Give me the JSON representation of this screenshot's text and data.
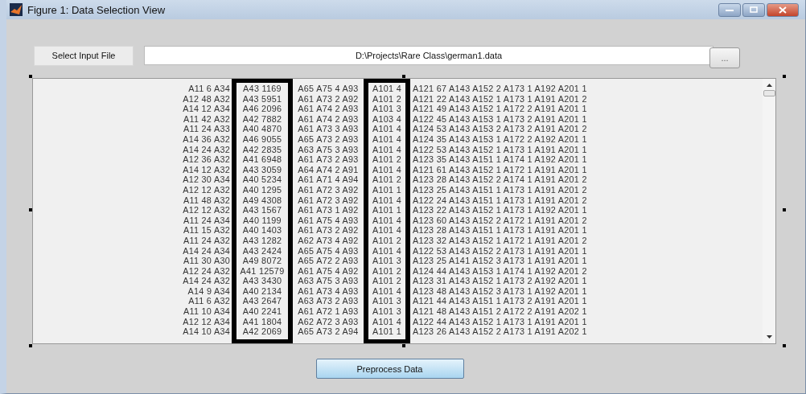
{
  "window": {
    "title": "Figure 1: Data Selection View"
  },
  "file_row": {
    "select_button": "Select Input File",
    "path": "D:\\Projects\\Rare Class\\german1.data",
    "browse_button": "..."
  },
  "list_rows": [
    "A11 6 A34 A43 1169 A65 A75 4 A93 A101 4 A121 67 A143 A152 2 A173 1 A192 A201 1",
    "A12 48 A32 A43 5951 A61 A73 2 A92 A101 2 A121 22 A143 A152 1 A173 1 A191 A201 2",
    "A14 12 A34 A46 2096 A61 A74 2 A93 A101 3 A121 49 A143 A152 1 A172 2 A191 A201 1",
    "A11 42 A32 A42 7882 A61 A74 2 A93 A103 4 A122 45 A143 A153 1 A173 2 A191 A201 1",
    "A11 24 A33 A40 4870 A61 A73 3 A93 A101 4 A124 53 A143 A153 2 A173 2 A191 A201 2",
    "A14 36 A32 A46 9055 A65 A73 2 A93 A101 4 A124 35 A143 A153 1 A172 2 A192 A201 1",
    "A14 24 A32 A42 2835 A63 A75 3 A93 A101 4 A122 53 A143 A152 1 A173 1 A191 A201 1",
    "A12 36 A32 A41 6948 A61 A73 2 A93 A101 2 A123 35 A143 A151 1 A174 1 A192 A201 1",
    "A14 12 A32 A43 3059 A64 A74 2 A91 A101 4 A121 61 A143 A152 1 A172 1 A191 A201 1",
    "A12 30 A34 A40 5234 A61 A71 4 A94 A101 2 A123 28 A143 A152 2 A174 1 A191 A201 2",
    "A12 12 A32 A40 1295 A61 A72 3 A92 A101 1 A123 25 A143 A151 1 A173 1 A191 A201 2",
    "A11 48 A32 A49 4308 A61 A72 3 A92 A101 4 A122 24 A143 A151 1 A173 1 A191 A201 2",
    "A12 12 A32 A43 1567 A61 A73 1 A92 A101 1 A123 22 A143 A152 1 A173 1 A192 A201 1",
    "A11 24 A34 A40 1199 A61 A75 4 A93 A101 4 A123 60 A143 A152 2 A172 1 A191 A201 2",
    "A11 15 A32 A40 1403 A61 A73 2 A92 A101 4 A123 28 A143 A151 1 A173 1 A191 A201 1",
    "A11 24 A32 A43 1282 A62 A73 4 A92 A101 2 A123 32 A143 A152 1 A172 1 A191 A201 2",
    "A14 24 A34 A43 2424 A65 A75 4 A93 A101 4 A122 53 A143 A152 2 A173 1 A191 A201 1",
    "A11 30 A30 A49 8072 A65 A72 2 A93 A101 3 A123 25 A141 A152 3 A173 1 A191 A201 1",
    "A12 24 A32 A41 12579 A61 A75 4 A92 A101 2 A124 44 A143 A153 1 A174 1 A192 A201 2",
    "A14 24 A32 A43 3430 A63 A75 3 A93 A101 2 A123 31 A143 A152 1 A173 2 A192 A201 1",
    "A14 9 A34 A40 2134 A61 A73 4 A93 A101 4 A123 48 A143 A152 3 A173 1 A192 A201 1",
    "A11 6 A32 A43 2647 A63 A73 2 A93 A101 3 A121 44 A143 A151 1 A173 2 A191 A201 1",
    "A11 10 A34 A40 2241 A61 A72 1 A93 A101 3 A121 48 A143 A151 2 A172 2 A191 A202 1",
    "A12 12 A34 A41 1804 A62 A72 3 A93 A101 4 A122 44 A143 A152 1 A173 1 A191 A201 1",
    "A14 10 A34 A42 2069 A65 A73 2 A94 A101 1 A123 26 A143 A152 2 A173 1 A191 A202 1"
  ],
  "action_button": "Preprocess Data"
}
